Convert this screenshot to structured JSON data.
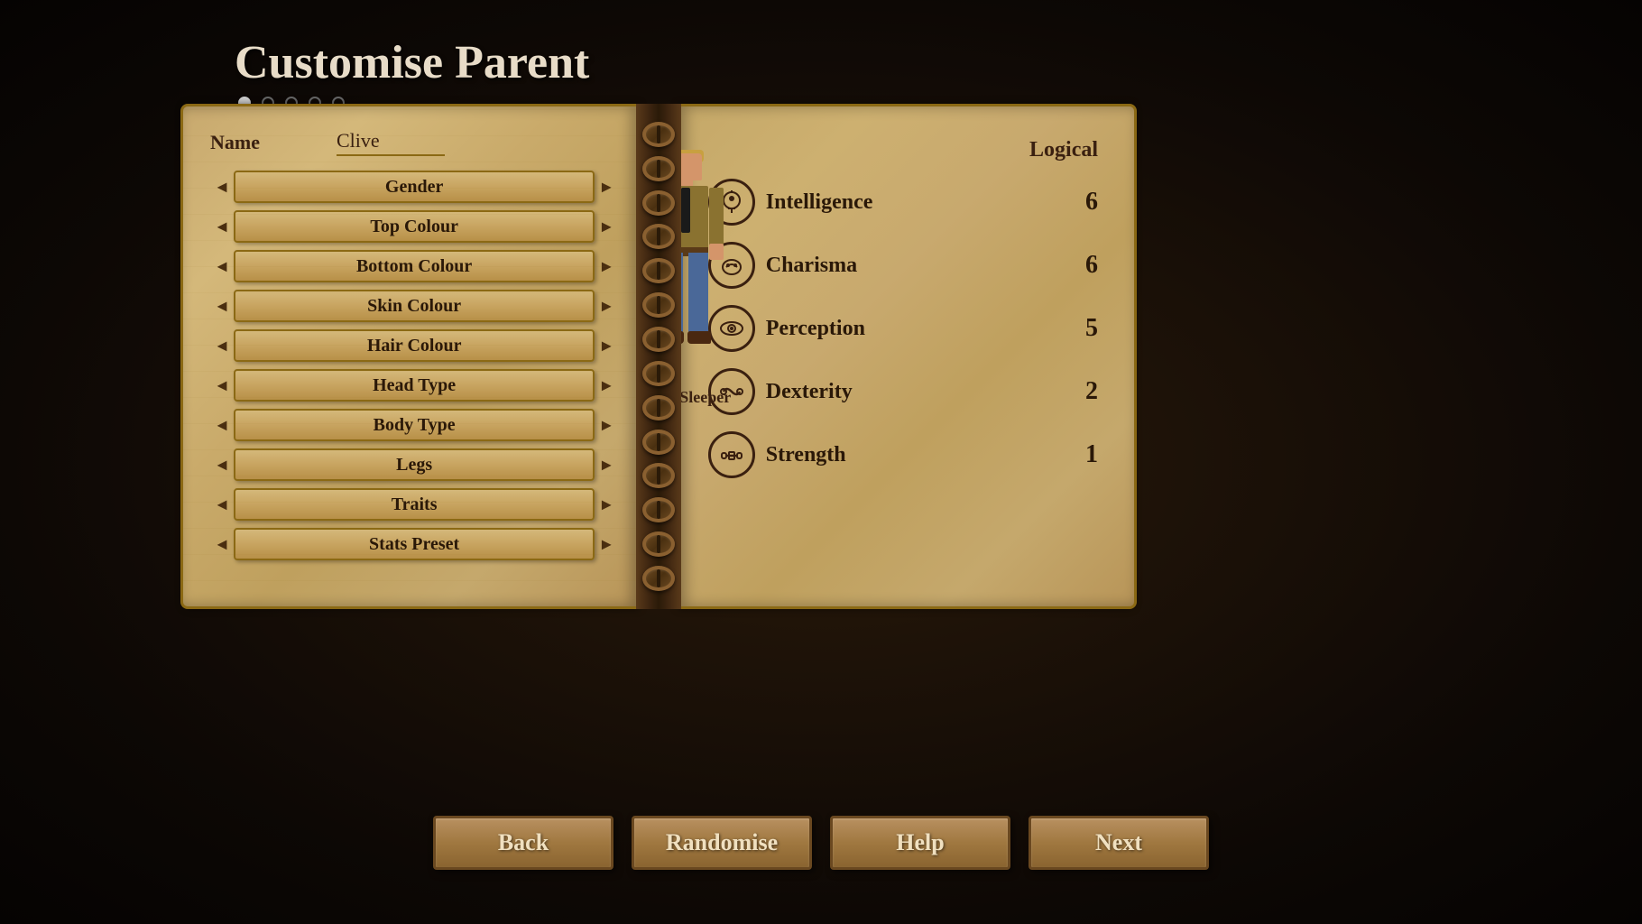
{
  "title": "Customise Parent",
  "dots": [
    {
      "active": true
    },
    {
      "active": false
    },
    {
      "active": false
    },
    {
      "active": false
    },
    {
      "active": false
    }
  ],
  "left_page": {
    "name_label": "Name",
    "name_value": "Clive",
    "options": [
      {
        "label": "Gender"
      },
      {
        "label": "Top Colour"
      },
      {
        "label": "Bottom Colour"
      },
      {
        "label": "Skin Colour"
      },
      {
        "label": "Hair Colour"
      },
      {
        "label": "Head Type"
      },
      {
        "label": "Body Type"
      },
      {
        "label": "Legs"
      },
      {
        "label": "Traits"
      },
      {
        "label": "Stats Preset"
      }
    ]
  },
  "character": {
    "label": "Deep Sleeper"
  },
  "right_page": {
    "category": "Logical",
    "stats": [
      {
        "name": "Intelligence",
        "value": "6",
        "icon": "💡"
      },
      {
        "name": "Charisma",
        "value": "6",
        "icon": "💬"
      },
      {
        "name": "Perception",
        "value": "5",
        "icon": "👁"
      },
      {
        "name": "Dexterity",
        "value": "2",
        "icon": "✋"
      },
      {
        "name": "Strength",
        "value": "1",
        "icon": "🏋"
      }
    ]
  },
  "buttons": [
    {
      "label": "Back",
      "name": "back-button"
    },
    {
      "label": "Randomise",
      "name": "randomise-button"
    },
    {
      "label": "Help",
      "name": "help-button"
    },
    {
      "label": "Next",
      "name": "next-button"
    }
  ]
}
